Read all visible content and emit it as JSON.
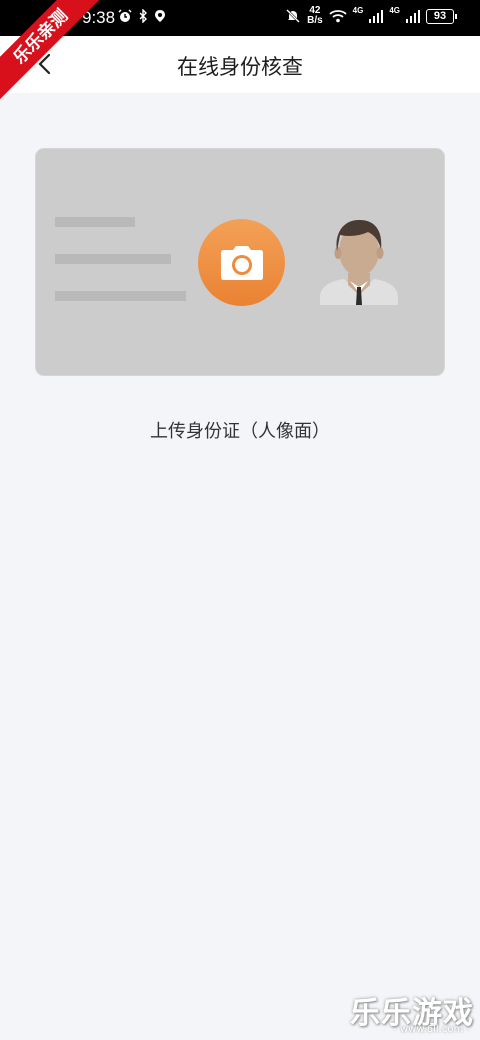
{
  "status_bar": {
    "time": "9:38",
    "speed_value": "42",
    "speed_unit": "B/s",
    "net1": "4G",
    "net2": "4G",
    "battery": "93"
  },
  "header": {
    "title": "在线身份核查"
  },
  "card": {
    "upload_label": "上传身份证（人像面）",
    "accent_color": "#ee8b3c"
  },
  "watermark": {
    "ribbon": "乐乐亲测",
    "brand": "乐乐游戏",
    "url": "- www.6ll.com -"
  }
}
